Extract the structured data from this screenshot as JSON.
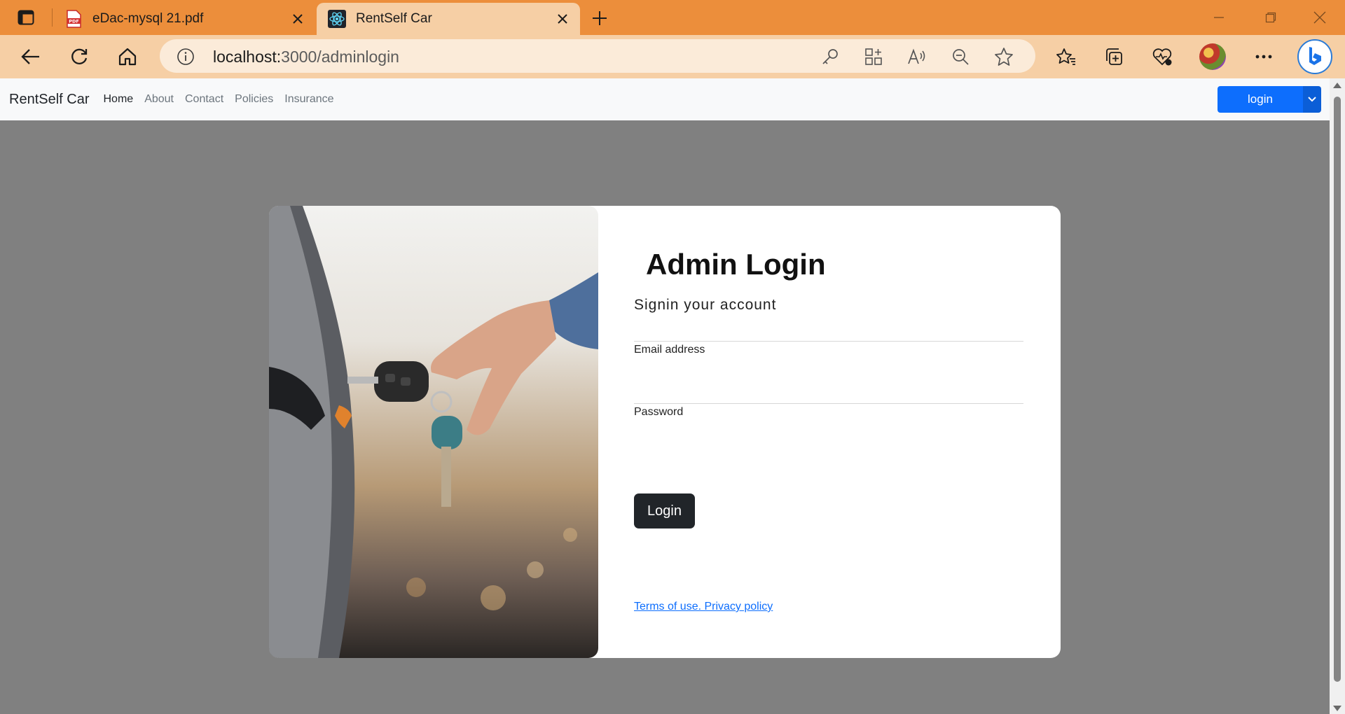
{
  "browser": {
    "tabs": [
      {
        "title": "eDac-mysql 21.pdf",
        "icon": "pdf-icon"
      },
      {
        "title": "RentSelf Car",
        "icon": "react-icon"
      }
    ],
    "url_host": "localhost:",
    "url_path": "3000/adminlogin"
  },
  "site": {
    "brand": "RentSelf Car",
    "nav_links": [
      "Home",
      "About",
      "Contact",
      "Policies",
      "Insurance"
    ],
    "login_button": "login"
  },
  "login_card": {
    "title": "Admin Login",
    "subtitle": "Signin your account",
    "email_label": "Email address",
    "email_value": "",
    "password_label": "Password",
    "password_value": "",
    "submit_label": "Login",
    "terms_link": "Terms of use. Privacy policy"
  },
  "colors": {
    "tabbar": "#ec8e3b",
    "toolbar": "#f6cfa5",
    "primary": "#0d6efd",
    "dark_button": "#212529",
    "page_background": "#808080"
  }
}
